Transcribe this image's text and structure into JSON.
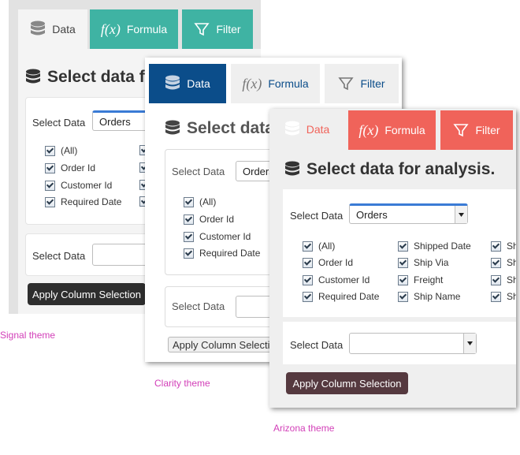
{
  "signal": {
    "tabs": {
      "data": "Data",
      "formula": "Formula",
      "filter": "Filter"
    },
    "heading": "Select data for analysis.",
    "select_label": "Select Data",
    "selected_table": "Orders",
    "columns": [
      "(All)",
      "Order Id",
      "Customer Id",
      "Required Date"
    ],
    "select_label_2": "Select Data",
    "apply_label": "Apply Column Selection",
    "caption": "Signal theme"
  },
  "clarity": {
    "tabs": {
      "data": "Data",
      "formula": "Formula",
      "filter": "Filter"
    },
    "heading": "Select data for analysis.",
    "select_label": "Select Data",
    "selected_table": "Orders",
    "columns": [
      "(All)",
      "Order Id",
      "Customer Id",
      "Required Date"
    ],
    "select_label_2": "Select Data",
    "apply_label": "Apply Column Selection",
    "caption": "Clarity theme"
  },
  "arizona": {
    "tabs": {
      "data": "Data",
      "formula": "Formula",
      "filter": "Filter"
    },
    "heading": "Select data for analysis.",
    "select_label": "Select Data",
    "selected_table": "Orders",
    "columns_col1": [
      "(All)",
      "Order Id",
      "Customer Id",
      "Required Date"
    ],
    "columns_col2": [
      "Shipped Date",
      "Ship Via",
      "Freight",
      "Ship Name"
    ],
    "columns_col3": [
      "Sh",
      "Sh",
      "Sh",
      "Sh"
    ],
    "select_label_2": "Select Data",
    "apply_label": "Apply Column Selection",
    "caption": "Arizona theme"
  },
  "icons": {
    "data": "database-icon",
    "formula": "function-icon",
    "filter": "funnel-icon"
  },
  "colors": {
    "signal_teal": "#3fb3a3",
    "clarity_blue": "#0b4d8a",
    "arizona_red": "#f0635a",
    "arizona_button": "#55393f",
    "caption_pink": "#d23fb8"
  }
}
